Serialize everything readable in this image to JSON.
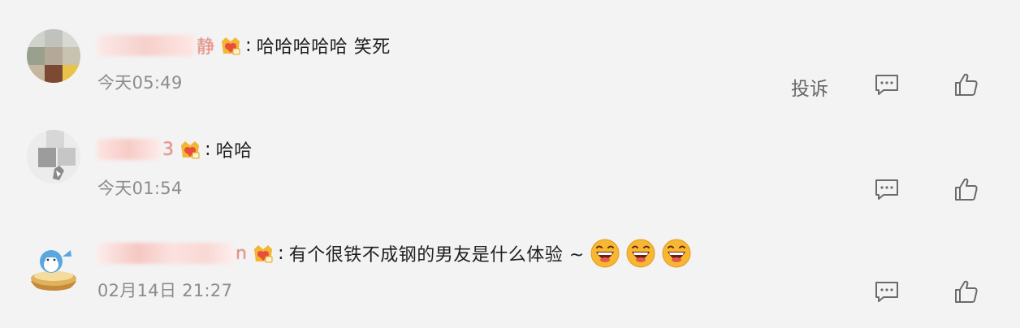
{
  "comments": [
    {
      "name_visible_tail": "静",
      "text": "哈哈哈哈哈 笑死",
      "time": "今天05:49",
      "report_label": "投诉",
      "emoji_count": 0
    },
    {
      "name_visible_tail": "3",
      "text": "哈哈",
      "time": "今天01:54",
      "emoji_count": 0
    },
    {
      "name_visible_tail": "n",
      "text": "有个很铁不成钢的男友是什么体验 ~",
      "time": "02月14日 21:27",
      "emoji_count": 3
    }
  ],
  "icons": {
    "badge": "fan-badge-icon",
    "comment": "comment-bubble-icon",
    "like": "thumbs-up-icon",
    "emoji": "laughing-emoji-icon"
  },
  "colors": {
    "background": "#f3f3f3",
    "text": "#1f1f1f",
    "time": "#8c8c8c",
    "icon": "#6b6b6b",
    "name_tint": "#f7c6c1",
    "badge_gold": "#f2b632",
    "badge_red": "#e84d3d"
  }
}
